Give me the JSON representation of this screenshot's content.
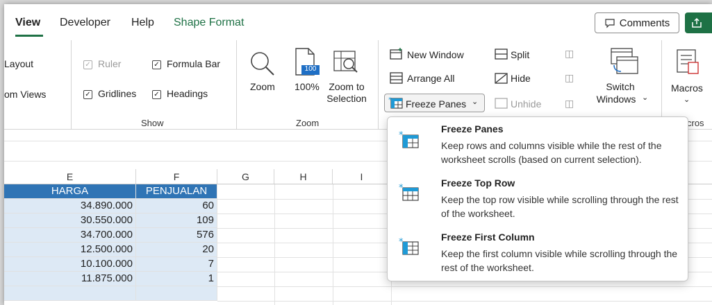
{
  "tabs": [
    {
      "label": "View",
      "active": true
    },
    {
      "label": "Developer"
    },
    {
      "label": "Help"
    },
    {
      "label": "Shape Format",
      "color": "#1e7145"
    }
  ],
  "header": {
    "comments_label": "Comments",
    "share_color": "#1e7145"
  },
  "ribbon": {
    "workbook_views": {
      "page_layout": "Layout",
      "custom_views": "om Views"
    },
    "show": {
      "ruler": {
        "label": "Ruler",
        "checked": true,
        "disabled": true
      },
      "formula_bar": {
        "label": "Formula Bar",
        "checked": true
      },
      "gridlines": {
        "label": "Gridlines",
        "checked": true
      },
      "headings": {
        "label": "Headings",
        "checked": true
      },
      "group_label": "Show"
    },
    "zoom": {
      "zoom": "Zoom",
      "zoom100": "100%",
      "zoom_badge": "100",
      "zoom_to_selection_1": "Zoom to",
      "zoom_to_selection_2": "Selection",
      "group_label": "Zoom"
    },
    "window": {
      "new_window": "New Window",
      "arrange_all": "Arrange All",
      "freeze_panes": "Freeze Panes",
      "split": "Split",
      "hide": "Hide",
      "unhide": "Unhide",
      "switch_windows_1": "Switch",
      "switch_windows_2": "Windows"
    },
    "macros": {
      "label": "Macros",
      "group_label": "cros"
    }
  },
  "columns": [
    "E",
    "F",
    "G",
    "H",
    "I"
  ],
  "table": {
    "headers": [
      "HARGA",
      "PENJUALAN"
    ],
    "rows": [
      [
        "34.890.000",
        "60"
      ],
      [
        "30.550.000",
        "109"
      ],
      [
        "34.700.000",
        "576"
      ],
      [
        "12.500.000",
        "20"
      ],
      [
        "10.100.000",
        "7"
      ],
      [
        "11.875.000",
        "1"
      ]
    ],
    "header_color": "#2f74b5",
    "cell_color": "#dde9f5"
  },
  "freeze_menu": {
    "items": [
      {
        "title": "Freeze Panes",
        "desc": "Keep rows and columns visible while the rest of the worksheet scrolls (based on current selection)."
      },
      {
        "title": "Freeze Top Row",
        "desc": "Keep the top row visible while scrolling through the rest of the worksheet."
      },
      {
        "title": "Freeze First Column",
        "desc": "Keep the first column visible while scrolling through the rest of the worksheet."
      }
    ]
  }
}
